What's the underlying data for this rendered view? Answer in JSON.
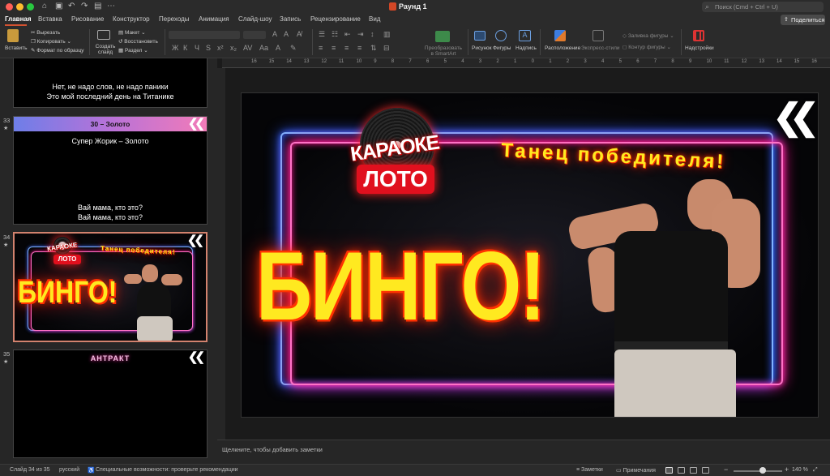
{
  "app": {
    "title": "Раунд 1",
    "search_placeholder": "Поиск (Cmd + Ctrl + U)",
    "quick_access_icons": [
      "home-icon",
      "save-icon",
      "undo-icon",
      "redo-icon",
      "new-doc-icon",
      "more-icon"
    ]
  },
  "tabs": [
    "Главная",
    "Вставка",
    "Рисование",
    "Конструктор",
    "Переходы",
    "Анимация",
    "Слайд-шоу",
    "Запись",
    "Рецензирование",
    "Вид"
  ],
  "active_tab": "Главная",
  "share_label": "Поделиться",
  "toolbar": {
    "paste": "Вставить",
    "cut": "Вырезать",
    "copy": "Копировать",
    "format_painter": "Формат по образцу",
    "new_slide": "Создать слайд",
    "layout": "Макет",
    "reset": "Восстановить",
    "section": "Раздел",
    "convert_smartart": "Преобразовать в SmartArt",
    "picture": "Рисунок",
    "shapes": "Фигуры",
    "textbox": "Надпись",
    "arrange": "Расположение",
    "quick_styles": "Экспресс-стили",
    "shape_fill": "Заливка фигуры",
    "shape_outline": "Контур фигуры",
    "addins": "Надстройки"
  },
  "ruler_marks": [
    "16",
    "15",
    "14",
    "13",
    "12",
    "11",
    "10",
    "9",
    "8",
    "7",
    "6",
    "5",
    "4",
    "3",
    "2",
    "1",
    "0",
    "1",
    "2",
    "3",
    "4",
    "5",
    "6",
    "7",
    "8",
    "9",
    "10",
    "11",
    "12",
    "13",
    "14",
    "15",
    "16"
  ],
  "slides": {
    "s32": {
      "line1": "Нет, не надо слов, не надо паники",
      "line2": "Это мой последний день на Титанике"
    },
    "s33": {
      "num": "33",
      "header": "30 – Золото",
      "song": "Супер Жорик – Золото",
      "line1": "Вай мама, кто это?",
      "line2": "Вай мама, кто это?"
    },
    "s34": {
      "num": "34"
    },
    "s35": {
      "num": "35",
      "title": "АНТРАКТ"
    }
  },
  "main_slide": {
    "logo_top": "КАРАОКЕ",
    "logo_bottom": "ЛОТО",
    "dance_text": "Танец победителя!",
    "bingo_text": "БИНГО!",
    "chevrons": "«"
  },
  "notes_placeholder": "Щелкните, чтобы добавить заметки",
  "status": {
    "slide_counter": "Слайд 34 из 35",
    "language": "русский",
    "accessibility": "Специальные возможности: проверьте рекомендации",
    "notes": "Заметки",
    "comments": "Примечания",
    "zoom": "140 %",
    "zoom_level_fraction": 0.6
  },
  "colors": {
    "accent": "#d35230",
    "neon_blue": "#7fb2ff",
    "neon_pink": "#ff72c6",
    "bingo_yellow": "#ffe920"
  }
}
